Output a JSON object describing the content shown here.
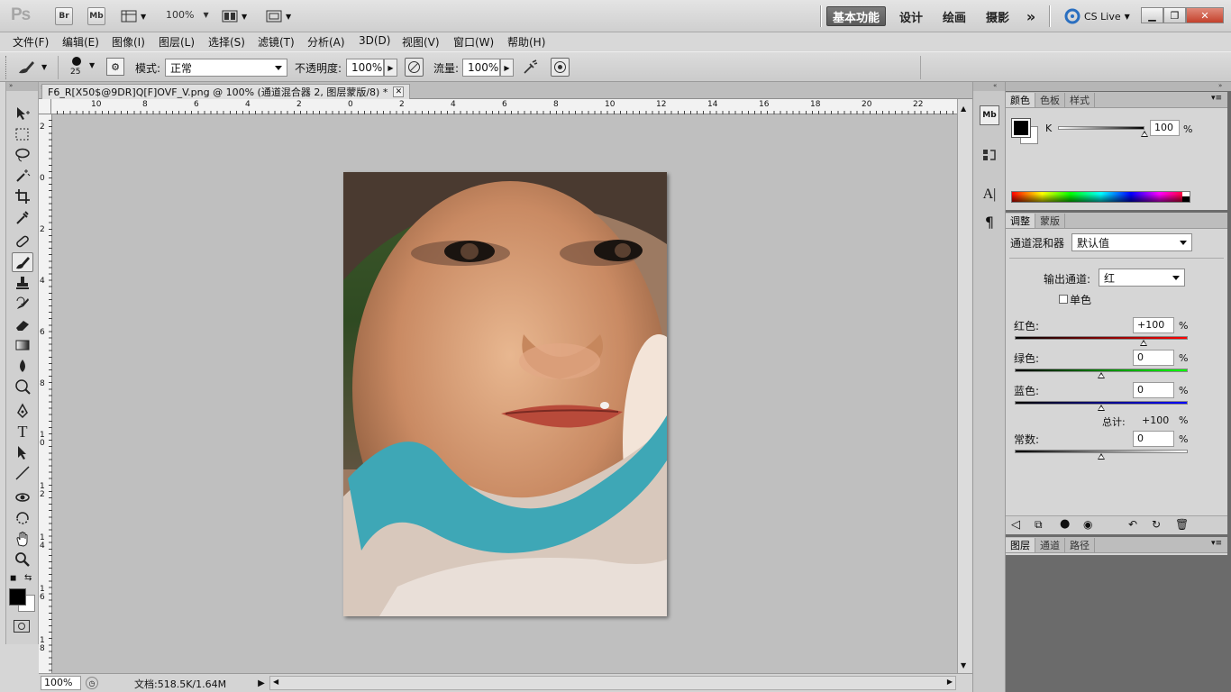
{
  "app": {
    "logo": "Ps",
    "bridge_label": "Br",
    "minibridge_label": "Mb",
    "zoom_level": "100%",
    "workspaces": [
      "基本功能",
      "设计",
      "绘画",
      "摄影"
    ],
    "more_label": "»",
    "cslive_label": "CS Live"
  },
  "menu": [
    "文件(F)",
    "编辑(E)",
    "图像(I)",
    "图层(L)",
    "选择(S)",
    "滤镜(T)",
    "分析(A)",
    "3D(D)",
    "视图(V)",
    "窗口(W)",
    "帮助(H)"
  ],
  "options": {
    "brush_size": "25",
    "mode_label": "模式:",
    "mode_value": "正常",
    "opacity_label": "不透明度:",
    "opacity_value": "100%",
    "flow_label": "流量:",
    "flow_value": "100%"
  },
  "document": {
    "tab_title": "F6_R[X50$@9DR]Q[F]OVF_V.png @ 100% (通道混合器 2, 图层蒙版/8) *",
    "ruler_h": [
      "10",
      "8",
      "6",
      "4",
      "2",
      "0",
      "2",
      "4",
      "6",
      "8",
      "10",
      "12",
      "14",
      "16",
      "18",
      "20",
      "22"
    ],
    "ruler_v": [
      "2",
      "0",
      "2",
      "4",
      "6",
      "8",
      "1 0",
      "1 2",
      "1 4",
      "1 6",
      "1 8"
    ],
    "status_zoom": "100%",
    "status_doc": "文档:518.5K/1.64M"
  },
  "color_panel": {
    "tabs": [
      "颜色",
      "色板",
      "样式"
    ],
    "channel": "K",
    "value": "100",
    "unit": "%",
    "k_level": 1.0
  },
  "adjust_panel": {
    "tabs": [
      "调整",
      "蒙版"
    ],
    "title": "通道混和器",
    "preset": "默认值",
    "output_label": "输出通道:",
    "output_value": "红",
    "mono_label": "单色",
    "red_label": "红色:",
    "red_value": "+100",
    "green_label": "绿色:",
    "green_value": "0",
    "blue_label": "蓝色:",
    "blue_value": "0",
    "total_label": "总计:",
    "total_value": "+100",
    "const_label": "常数:",
    "const_value": "0",
    "pct": "%"
  },
  "layers_panel": {
    "tabs": [
      "图层",
      "通道",
      "路径"
    ]
  },
  "colors": {
    "accent_active": "#5e5e5e",
    "canvas_bg": "#bfbfbf"
  }
}
